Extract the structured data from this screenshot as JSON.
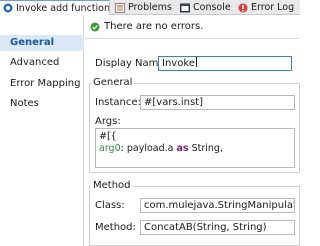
{
  "tabs": {
    "active": {
      "label": "Invoke add function",
      "icon": "mule-icon"
    },
    "problems": {
      "label": "Problems",
      "icon": "problems-icon"
    },
    "console": {
      "label": "Console",
      "icon": "console-icon"
    },
    "error_log": {
      "label": "Error Log",
      "icon": "error-log-icon"
    }
  },
  "sidebar": {
    "items": [
      {
        "label": "General",
        "active": true
      },
      {
        "label": "Advanced",
        "active": false
      },
      {
        "label": "Error Mapping",
        "active": false
      },
      {
        "label": "Notes",
        "active": false
      }
    ]
  },
  "status": {
    "icon": "check-circle-icon",
    "text": "There are no errors."
  },
  "display_name": {
    "label": "Display Name:",
    "value": "Invoke"
  },
  "general": {
    "title": "General",
    "instance_label": "Instance:",
    "instance_value": "#[vars.inst]",
    "args_label": "Args:",
    "args_code": {
      "line1": "#[{",
      "line2_key": "arg0",
      "line2_colon": ": payload.a ",
      "line2_kw": "as",
      "line2_rest": " String,"
    }
  },
  "method": {
    "title": "Method",
    "class_label": "Class:",
    "class_value": "com.mulejava.StringManipulation",
    "method_label": "Method:",
    "method_value": "ConcatAB(String, String)"
  },
  "colors": {
    "accent": "#3c7fcf",
    "success": "#3a9a3a",
    "selection": "#dbe8f6",
    "code_key": "#2e8b3e",
    "code_keyword": "#7a1f7a"
  }
}
